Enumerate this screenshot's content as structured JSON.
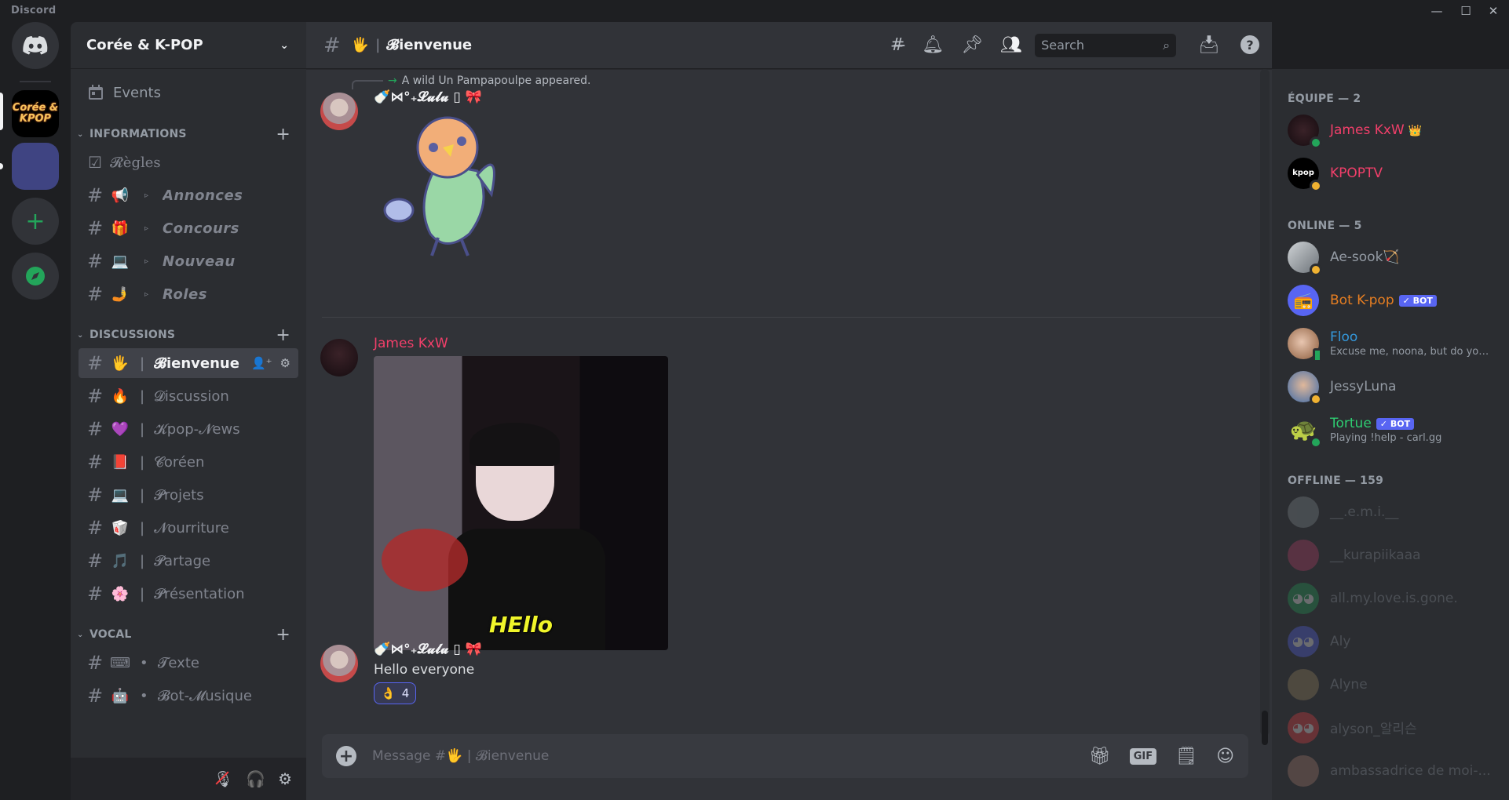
{
  "window": {
    "app_name": "Discord",
    "minimize": "—",
    "maximize": "☐",
    "close": "✕"
  },
  "server_rail": {
    "home_icon": "discord-logo-icon",
    "servers": [
      {
        "name": "Corée & K-POP",
        "label": "Corée & KPOP",
        "selected": true
      },
      {
        "name": "folder",
        "label": ""
      }
    ],
    "add_server": "+",
    "explore": "compass-icon"
  },
  "sidebar": {
    "server_name": "Corée & K-POP",
    "events_label": "Events",
    "categories": [
      {
        "label": "INFORMATIONS",
        "channels": [
          {
            "icon": "rules-icon",
            "emoji": "☑",
            "name": "𝓡ègles",
            "type": "rules"
          },
          {
            "emoji": "📢",
            "name": "Annonces",
            "style": "italic",
            "prefix": "▹"
          },
          {
            "emoji": "🎁",
            "name": "Concours",
            "style": "italic",
            "prefix": "▹"
          },
          {
            "emoji": "💻",
            "name": "Nouveau",
            "style": "italic",
            "prefix": "▹"
          },
          {
            "emoji": "🤳",
            "name": "Roles",
            "style": "italic",
            "prefix": "▹"
          }
        ]
      },
      {
        "label": "DISCUSSIONS",
        "channels": [
          {
            "emoji": "🖐",
            "name": "𝓑ienvenue",
            "active": true
          },
          {
            "emoji": "🔥",
            "name": "𝓓iscussion"
          },
          {
            "emoji": "💜",
            "name": "𝓚pop-𝓝ews"
          },
          {
            "emoji": "📕",
            "name": "𝓒oréen"
          },
          {
            "emoji": "💻",
            "name": "𝓟rojets"
          },
          {
            "emoji": "🥡",
            "name": "𝓝ourriture"
          },
          {
            "emoji": "🎵",
            "name": "𝓟artage"
          },
          {
            "emoji": "🌸",
            "name": "𝓟résentation"
          }
        ]
      },
      {
        "label": "VOCAL",
        "channels": [
          {
            "emoji": "⌨",
            "name": "𝓣exte",
            "prefix": "•"
          },
          {
            "emoji": "🤖",
            "name": "𝓑ot-𝓜usique",
            "prefix": "•"
          }
        ]
      }
    ],
    "userbar": {
      "mute": "mic-muted-icon",
      "deafen": "headphones-icon",
      "settings": "gear-icon"
    }
  },
  "chat": {
    "channel_emoji": "🖐",
    "channel_name": "𝓑ienvenue",
    "search_placeholder": "Search",
    "messages": [
      {
        "reply_text": "A wild Un Pampapoulpe appeared.",
        "author": "🍼⋈°₊𝓛𝓾𝓵𝓾 ▯ 🎀",
        "author_color": "#f2f3f5",
        "attachment": "sticker-parrot"
      },
      {
        "author": "James KxW",
        "author_color": "#f23f6a",
        "attachment": "gif-hello",
        "gif_caption": "HEllo"
      },
      {
        "author": "🍼⋈°₊𝓛𝓾𝓵𝓾 ▯ 🎀",
        "author_color": "#f2f3f5",
        "text": "Hello everyone",
        "reaction": {
          "emoji": "👌",
          "count": "4"
        }
      }
    ],
    "composer_placeholder": "Message #🖐 | 𝓑ienvenue",
    "composer_icons": [
      "gift-icon",
      "gif-icon",
      "sticker-icon",
      "emoji-icon"
    ],
    "gif_label": "GIF"
  },
  "members": {
    "groups": [
      {
        "header": "ÉQUIPE — 2",
        "members": [
          {
            "name": "James KxW",
            "color": "#f23f6a",
            "status": "online",
            "badge": "👑"
          },
          {
            "name": "KPOPTV",
            "color": "#f23f6a",
            "status": "idle"
          }
        ]
      },
      {
        "header": "ONLINE — 5",
        "members": [
          {
            "name": "Ae-sook🏹",
            "color": "#949ba4",
            "status": "idle"
          },
          {
            "name": "Bot K-pop",
            "color": "#e67e22",
            "status": "none",
            "bot": "✓ BOT"
          },
          {
            "name": "Floo",
            "color": "#3498db",
            "status": "mobile",
            "sub": "Excuse me, noona, but do you ..."
          },
          {
            "name": "JessyLuna",
            "color": "#949ba4",
            "status": "idle"
          },
          {
            "name": "Tortue",
            "color": "#2ecc71",
            "status": "online",
            "bot": "✓ BOT",
            "sub": "Playing !help - carl.gg"
          }
        ]
      },
      {
        "header": "OFFLINE — 159",
        "members": [
          {
            "name": "__.e.m.i.__"
          },
          {
            "name": "__kurapiikaaa"
          },
          {
            "name": "all.my.love.is.gone."
          },
          {
            "name": "Aly"
          },
          {
            "name": "Alyne"
          },
          {
            "name": "alyson_알리슨"
          },
          {
            "name": "ambassadrice de moi-..."
          }
        ]
      }
    ]
  }
}
